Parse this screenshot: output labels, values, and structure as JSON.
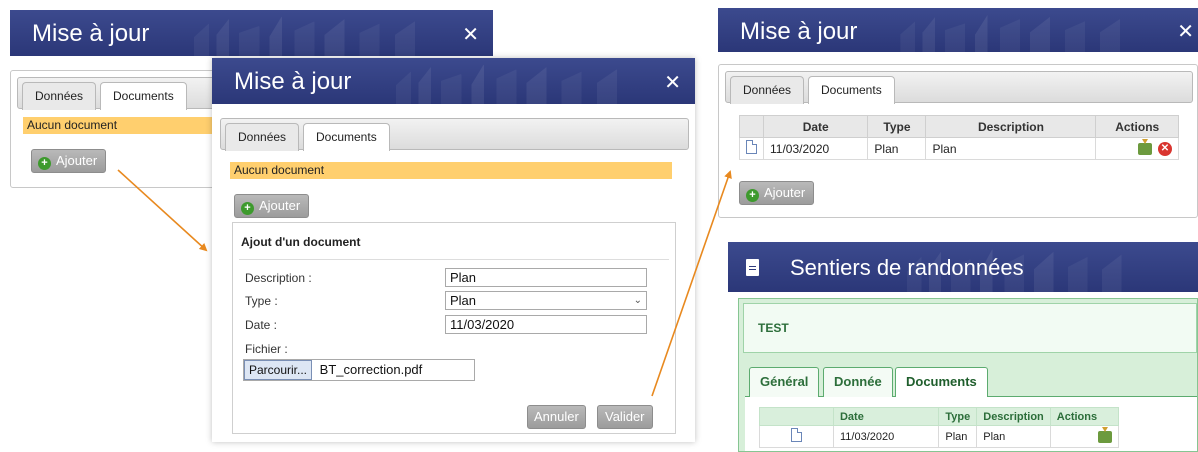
{
  "dialog1": {
    "title": "Mise à jour",
    "close": "✕",
    "tabs": [
      "Données",
      "Documents"
    ],
    "notice": "Aucun document",
    "add_label": "Ajouter"
  },
  "dialog2": {
    "title": "Mise à jour",
    "close": "✕",
    "tabs": [
      "Données",
      "Documents"
    ],
    "notice": "Aucun document",
    "add_label": "Ajouter",
    "form": {
      "heading": "Ajout d'un document",
      "description_label": "Description :",
      "description_value": "Plan",
      "type_label": "Type :",
      "type_value": "Plan",
      "date_label": "Date :",
      "date_value": "11/03/2020",
      "file_label": "Fichier :",
      "browse_label": "Parcourir...",
      "file_name": "BT_correction.pdf",
      "cancel_label": "Annuler",
      "submit_label": "Valider"
    }
  },
  "dialog3": {
    "title": "Mise à jour",
    "close": "✕",
    "tabs": [
      "Données",
      "Documents"
    ],
    "table": {
      "headers": [
        "Date",
        "Type",
        "Description",
        "Actions"
      ],
      "rows": [
        {
          "date": "11/03/2020",
          "type": "Plan",
          "description": "Plan"
        }
      ]
    },
    "add_label": "Ajouter"
  },
  "panel4": {
    "title": "Sentiers de randonnées",
    "record_name": "TEST",
    "tabs": [
      "Général",
      "Donnée",
      "Documents"
    ],
    "table": {
      "headers": [
        "Date",
        "Type",
        "Description",
        "Actions"
      ],
      "rows": [
        {
          "date": "11/03/2020",
          "type": "Plan",
          "description": "Plan"
        }
      ]
    }
  },
  "icons": {
    "close": "close-icon",
    "add": "plus-circle-icon",
    "document": "document-icon",
    "download": "download-icon",
    "delete": "delete-icon",
    "header_doc": "document-icon",
    "select": "chevron-down-icon"
  },
  "colors": {
    "title_bar": "#2e3a7c",
    "notice": "#ffcf6e",
    "add_icon": "#3d9a2d",
    "delete_icon": "#d9352f",
    "arrow": "#e8891f",
    "green_accent": "#5cab6f"
  }
}
